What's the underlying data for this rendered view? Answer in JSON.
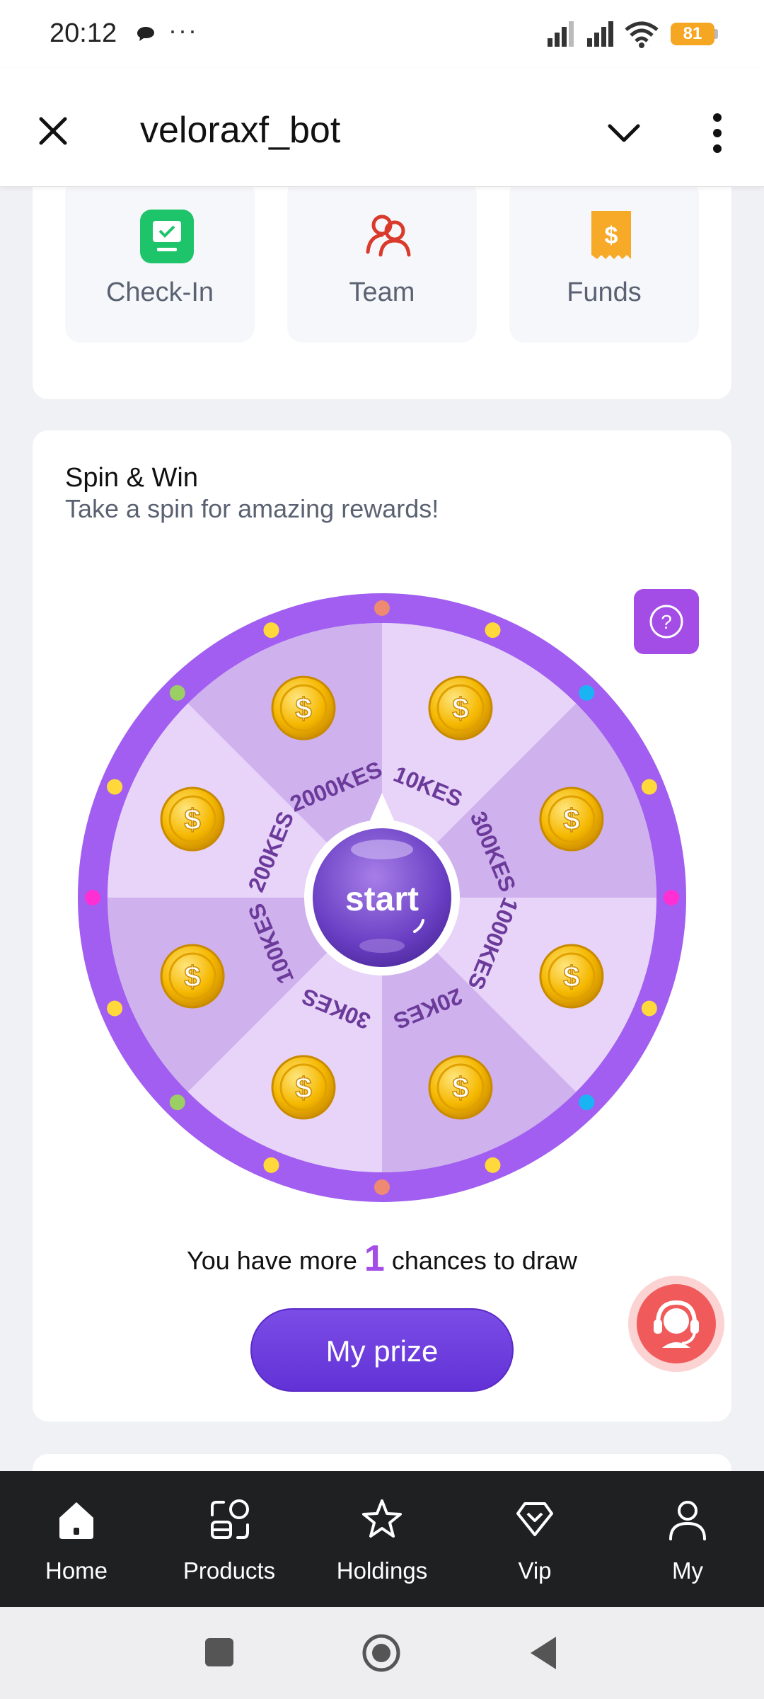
{
  "status_bar": {
    "time": "20:12",
    "dots": "···",
    "battery": "81"
  },
  "header": {
    "title": "veloraxf_bot"
  },
  "quick_actions": [
    {
      "label": "Check-In",
      "icon": "check-in-icon"
    },
    {
      "label": "Team",
      "icon": "team-icon"
    },
    {
      "label": "Funds",
      "icon": "funds-icon"
    }
  ],
  "spin": {
    "title": "Spin & Win",
    "subtitle": "Take a spin for amazing rewards!",
    "start_label": "start",
    "segments": [
      "10KES",
      "300KES",
      "1000KES",
      "20KES",
      "30KES",
      "100KES",
      "200KES",
      "2000KES"
    ],
    "chances_prefix": "You have more",
    "chances_count": "1",
    "chances_suffix": "chances to draw",
    "prize_button": "My prize",
    "accent": "#a34de6"
  },
  "nav": [
    {
      "label": "Home",
      "icon": "home-icon"
    },
    {
      "label": "Products",
      "icon": "products-icon"
    },
    {
      "label": "Holdings",
      "icon": "star-icon"
    },
    {
      "label": "Vip",
      "icon": "diamond-icon"
    },
    {
      "label": "My",
      "icon": "user-icon"
    }
  ]
}
